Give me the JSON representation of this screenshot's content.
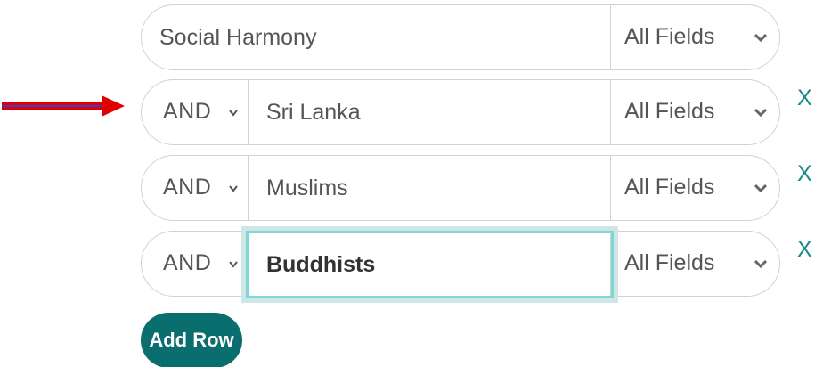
{
  "rows": [
    {
      "term": "Social Harmony",
      "field": "All Fields"
    },
    {
      "operator": "AND",
      "term": "Sri Lanka",
      "field": "All Fields",
      "remove_label": "X"
    },
    {
      "operator": "AND",
      "term": "Muslims",
      "field": "All Fields",
      "remove_label": "X"
    },
    {
      "operator": "AND",
      "term": "Buddhists",
      "field": "All Fields",
      "remove_label": "X"
    }
  ],
  "add_row_label": "Add Row",
  "colors": {
    "accent": "#0b6e6e",
    "remove_x": "#1a8a8a",
    "focus_ring": "#7fd6d6",
    "annotation_arrow": "#e00000"
  },
  "icons": {
    "dropdown": "chevron-down-icon",
    "annotation": "red-arrow-annotation-icon"
  }
}
